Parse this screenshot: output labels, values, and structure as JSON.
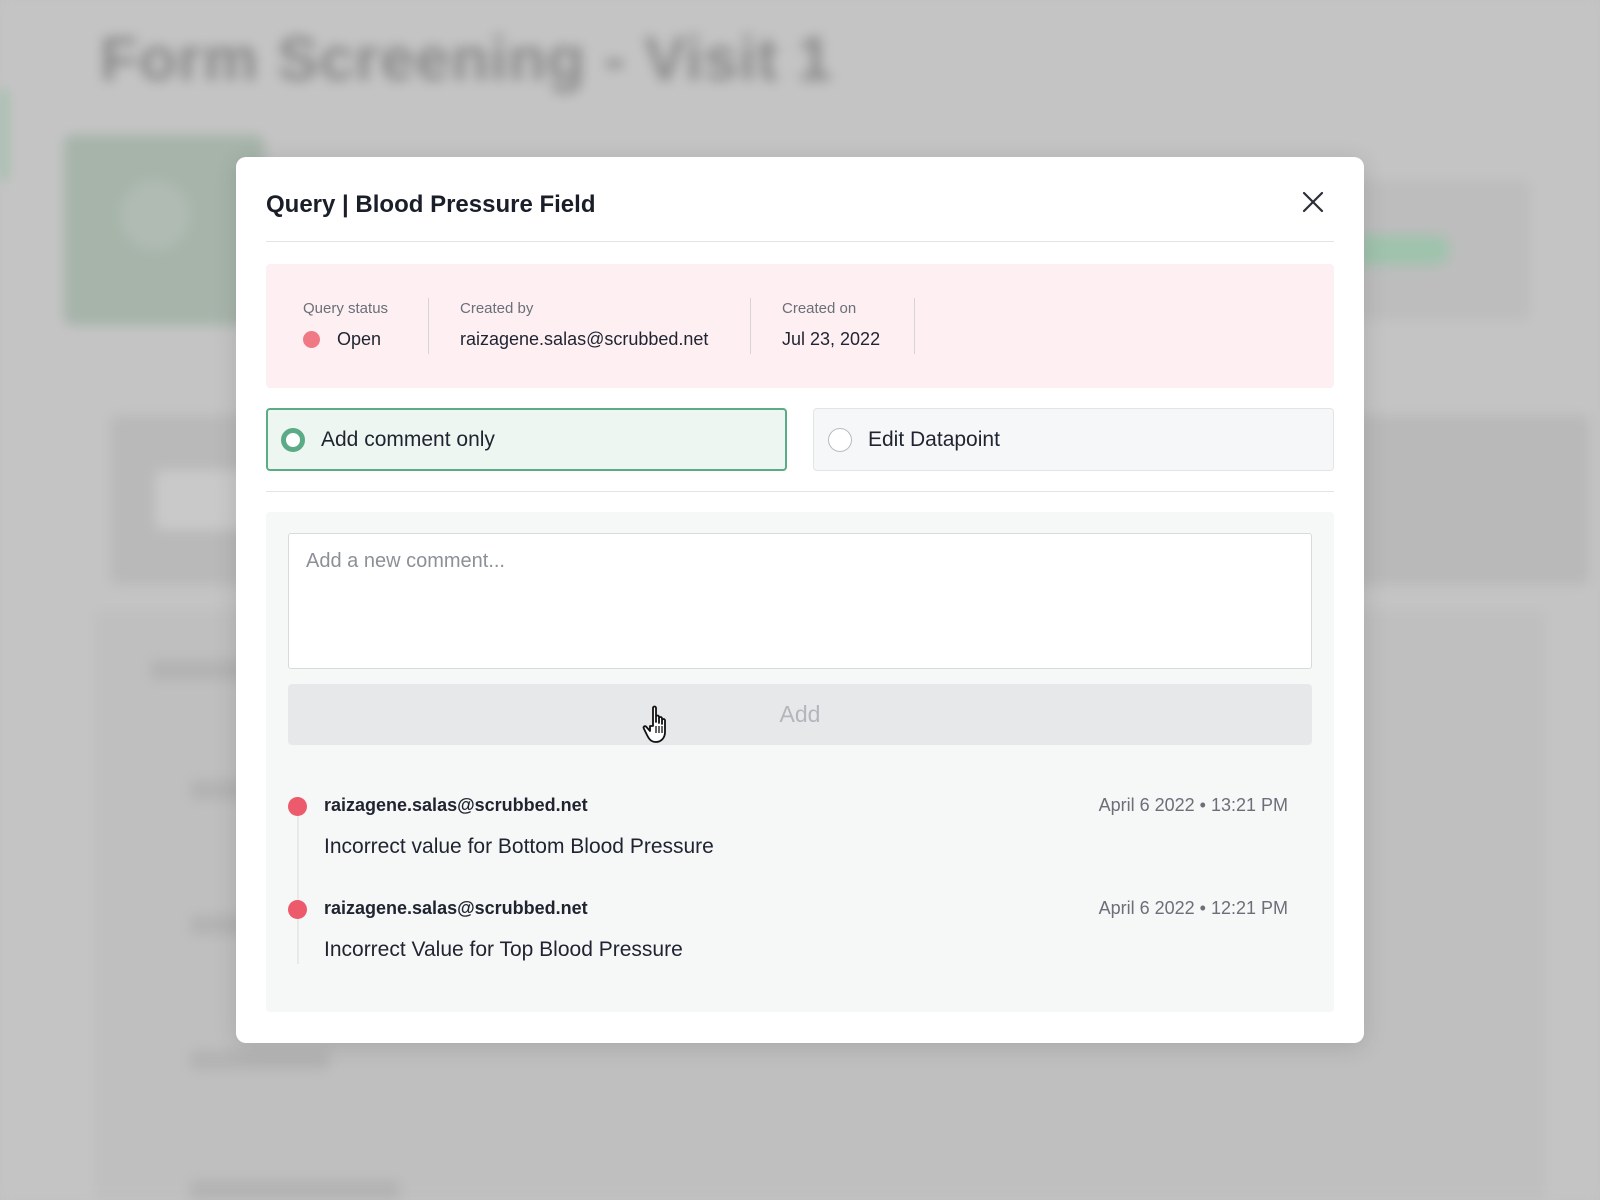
{
  "background": {
    "page_title": "Form Screening - Visit 1"
  },
  "modal": {
    "title": "Query | Blood Pressure Field",
    "close_icon": "close-icon",
    "info": {
      "status_label": "Query status",
      "status_value": "Open",
      "status_color": "#ef7a86",
      "created_by_label": "Created by",
      "created_by_value": "raizagene.salas@scrubbed.net",
      "created_on_label": "Created on",
      "created_on_value": "Jul 23, 2022"
    },
    "options": [
      {
        "label": "Add comment only",
        "selected": true
      },
      {
        "label": "Edit Datapoint",
        "selected": false
      }
    ],
    "comment_input": {
      "placeholder": "Add a new comment...",
      "value": ""
    },
    "add_button_label": "Add",
    "comments": [
      {
        "author": "raizagene.salas@scrubbed.net",
        "timestamp": "April 6 2022 • 13:21 PM",
        "text": "Incorrect value for Bottom Blood Pressure"
      },
      {
        "author": "raizagene.salas@scrubbed.net",
        "timestamp": "April 6 2022 • 12:21 PM",
        "text": "Incorrect Value for Top Blood Pressure"
      }
    ],
    "colors": {
      "accent_green": "#5bab87",
      "comment_dot": "#ec5a6c",
      "info_bg": "#fdeff2"
    }
  }
}
